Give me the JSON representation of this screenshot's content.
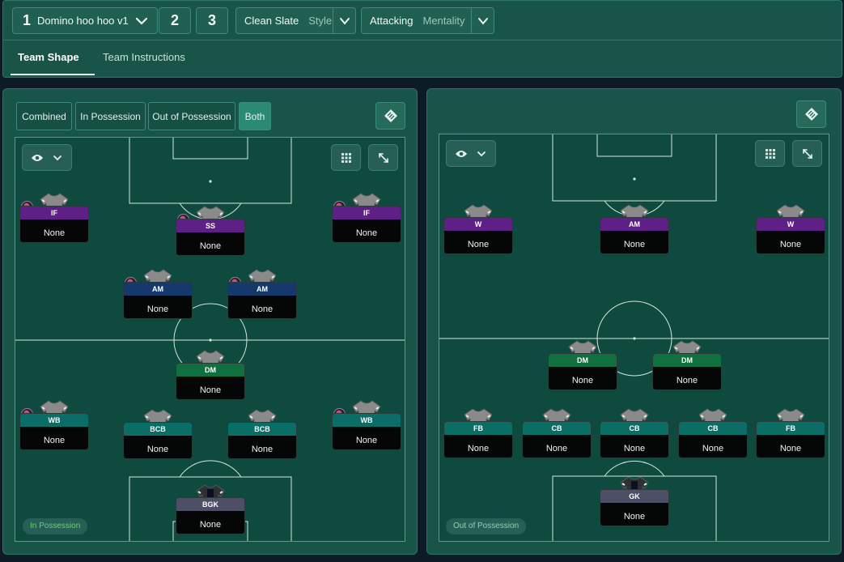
{
  "header": {
    "tactic": {
      "number": "1",
      "name": "Domino hoo hoo v1"
    },
    "slot_2": "2",
    "slot_3": "3",
    "style": {
      "value": "Clean Slate",
      "label": "Style"
    },
    "mentality": {
      "value": "Attacking",
      "label": "Mentality"
    },
    "tabs": [
      "Team Shape",
      "Team Instructions"
    ]
  },
  "left_panel": {
    "phase_buttons": [
      "Combined",
      "In Possession",
      "Out of Possession",
      "Both"
    ],
    "active_phase": "Both",
    "badge": "In Possession",
    "players": [
      {
        "role": "IF",
        "duty": "None",
        "color": "purple",
        "trait": true
      },
      {
        "role": "SS",
        "duty": "None",
        "color": "purple",
        "trait": true
      },
      {
        "role": "IF",
        "duty": "None",
        "color": "purple",
        "trait": true
      },
      {
        "role": "AM",
        "duty": "None",
        "color": "blue",
        "trait": true
      },
      {
        "role": "AM",
        "duty": "None",
        "color": "blue",
        "trait": true
      },
      {
        "role": "DM",
        "duty": "None",
        "color": "green",
        "trait": false
      },
      {
        "role": "WB",
        "duty": "None",
        "color": "teal",
        "trait": true
      },
      {
        "role": "BCB",
        "duty": "None",
        "color": "teal",
        "trait": false
      },
      {
        "role": "BCB",
        "duty": "None",
        "color": "teal",
        "trait": false
      },
      {
        "role": "WB",
        "duty": "None",
        "color": "teal",
        "trait": true
      },
      {
        "role": "BGK",
        "duty": "None",
        "color": "gray",
        "trait": false,
        "keeper": true
      }
    ]
  },
  "right_panel": {
    "badge": "Out of Possession",
    "players": [
      {
        "role": "W",
        "duty": "None",
        "color": "purple"
      },
      {
        "role": "AM",
        "duty": "None",
        "color": "purple"
      },
      {
        "role": "W",
        "duty": "None",
        "color": "purple"
      },
      {
        "role": "DM",
        "duty": "None",
        "color": "green"
      },
      {
        "role": "DM",
        "duty": "None",
        "color": "green"
      },
      {
        "role": "FB",
        "duty": "None",
        "color": "teal"
      },
      {
        "role": "CB",
        "duty": "None",
        "color": "teal"
      },
      {
        "role": "CB",
        "duty": "None",
        "color": "teal"
      },
      {
        "role": "CB",
        "duty": "None",
        "color": "teal"
      },
      {
        "role": "FB",
        "duty": "None",
        "color": "teal"
      },
      {
        "role": "GK",
        "duty": "None",
        "color": "gray",
        "keeper": true
      }
    ]
  },
  "icons": {
    "dropdown": "chevron-down-icon",
    "eye": "eye-icon",
    "grid": "grid-dots-icon",
    "expand": "expand-icon",
    "diamond": "pitch-diamond-icon",
    "trait": "player-trait-icon"
  },
  "colors": {
    "purple": "#5e1f87",
    "blue": "#15386d",
    "green": "#11703f",
    "teal": "#0b6e66",
    "gray": "#4c4f66",
    "panel": "#195448",
    "pitch": "#0f4a3f"
  }
}
